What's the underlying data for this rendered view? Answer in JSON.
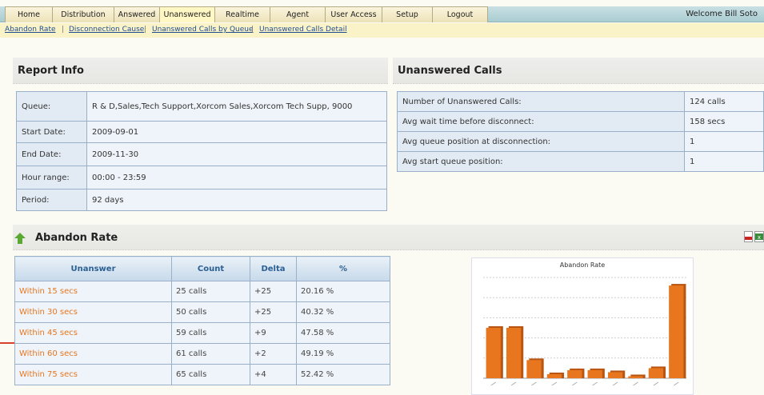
{
  "nav": {
    "tabs": [
      "Home",
      "Distribution",
      "Answered",
      "Unanswered",
      "Realtime",
      "Agent",
      "User Access",
      "Setup",
      "Logout"
    ],
    "active_tab": "Unanswered",
    "welcome": "Welcome Bill Soto"
  },
  "subnav": {
    "links": [
      "Abandon Rate",
      "Disconnection Cause",
      "Unanswered Calls by Queue",
      "Unanswered Calls Detail"
    ]
  },
  "report_info": {
    "title": "Report Info",
    "rows": [
      {
        "key": "Queue:",
        "value": "R & D,Sales,Tech Support,Xorcom Sales,Xorcom Tech Supp, 9000"
      },
      {
        "key": "Start Date:",
        "value": "2009-09-01"
      },
      {
        "key": "End Date:",
        "value": "2009-11-30"
      },
      {
        "key": "Hour range:",
        "value": "00:00 - 23:59"
      },
      {
        "key": "Period:",
        "value": "92 days"
      }
    ]
  },
  "unanswered_calls": {
    "title": "Unanswered Calls",
    "rows": [
      {
        "key": "Number of Unanswered Calls:",
        "value": "124 calls"
      },
      {
        "key": "Avg wait time before disconnect:",
        "value": "158 secs"
      },
      {
        "key": "Avg queue position at disconnection:",
        "value": "1"
      },
      {
        "key": "Avg start queue position:",
        "value": "1"
      }
    ]
  },
  "abandon_rate": {
    "title": "Abandon Rate",
    "columns": [
      "Unanswer",
      "Count",
      "Delta",
      "%"
    ],
    "rows": [
      {
        "label": "Within 15 secs",
        "count": "25 calls",
        "delta": "+25",
        "pct": "20.16 %"
      },
      {
        "label": "Within 30 secs",
        "count": "50 calls",
        "delta": "+25",
        "pct": "40.32 %"
      },
      {
        "label": "Within 45 secs",
        "count": "59 calls",
        "delta": "+9",
        "pct": "47.58 %"
      },
      {
        "label": "Within 60 secs",
        "count": "61 calls",
        "delta": "+2",
        "pct": "49.19 %"
      },
      {
        "label": "Within 75 secs",
        "count": "65 calls",
        "delta": "+4",
        "pct": "52.42 %"
      }
    ]
  },
  "chart_data": {
    "type": "bar",
    "title": "Abandon Rate",
    "categories": [],
    "values": [
      25,
      25,
      9,
      2,
      4,
      4,
      3,
      1,
      5,
      46
    ],
    "ylim": [
      0,
      50
    ],
    "grid": true,
    "bar_color": "#e8761e"
  },
  "colors": {
    "accent_orange": "#e8761e",
    "link_blue": "#1f4d8f",
    "header_blue": "#2a5f94"
  },
  "icons": {
    "sort": "up-arrow-icon",
    "pdf": "pdf-icon",
    "excel": "excel-icon"
  }
}
